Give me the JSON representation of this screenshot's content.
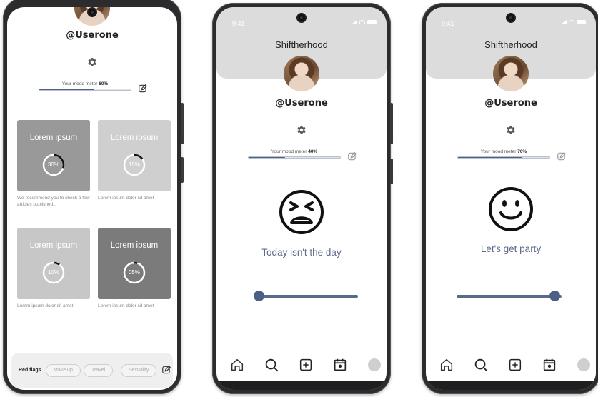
{
  "screens": [
    {
      "username": "@Userone",
      "mood_label": "Your mood meter",
      "mood_value": "60%",
      "mood_fraction": 0.6,
      "cards": [
        {
          "title": "Lorem ipsum",
          "percent_label": "30%",
          "progress": 0.3,
          "bg_color": "#999999",
          "caption": "We recommend you to check a few articles published..."
        },
        {
          "title": "Lorem ipsum",
          "percent_label": "15%",
          "progress": 0.15,
          "bg_color": "#cfcfcf",
          "caption": "Lorem ipsum dolor sit amet"
        },
        {
          "title": "Lorem ipsum",
          "percent_label": "10%",
          "progress": 0.1,
          "bg_color": "#c7c7c7",
          "caption": "Lorem ipsum dolor sit amet"
        },
        {
          "title": "Lorem ipsum",
          "percent_label": "05%",
          "progress": 0.05,
          "bg_color": "#7b7b7b",
          "caption": "Lorem ipsum dolor sit amet"
        }
      ],
      "tags_label": "Red flags",
      "tags": [
        "Make up",
        "Travel",
        "Sexuality"
      ],
      "icons": {
        "gear": "gear-icon",
        "edit": "edit-icon",
        "tags_edit": "edit-icon"
      }
    },
    {
      "time": "9:41",
      "app_title": "Shiftherhood",
      "username": "@Userone",
      "mood_label": "Your mood meter",
      "mood_value": "40%",
      "mood_fraction": 0.4,
      "face": "tired-face-icon",
      "message": "Today isn't the day",
      "slider_value": 0.05,
      "nav": [
        "home-icon",
        "search-icon",
        "plus-square-icon",
        "calendar-icon",
        "profile-avatar"
      ]
    },
    {
      "time": "9:41",
      "app_title": "Shiftherhood",
      "username": "@Userone",
      "mood_label": "Your mood meter",
      "mood_value": "70%",
      "mood_fraction": 0.7,
      "face": "smiling-face-icon",
      "message": "Let's get party",
      "slider_value": 0.93,
      "nav": [
        "home-icon",
        "search-icon",
        "plus-square-icon",
        "calendar-icon",
        "profile-avatar"
      ]
    }
  ],
  "colors": {
    "accent": "#4d5f85",
    "message": "#5d6b8c",
    "header": "#dcdcdc"
  }
}
